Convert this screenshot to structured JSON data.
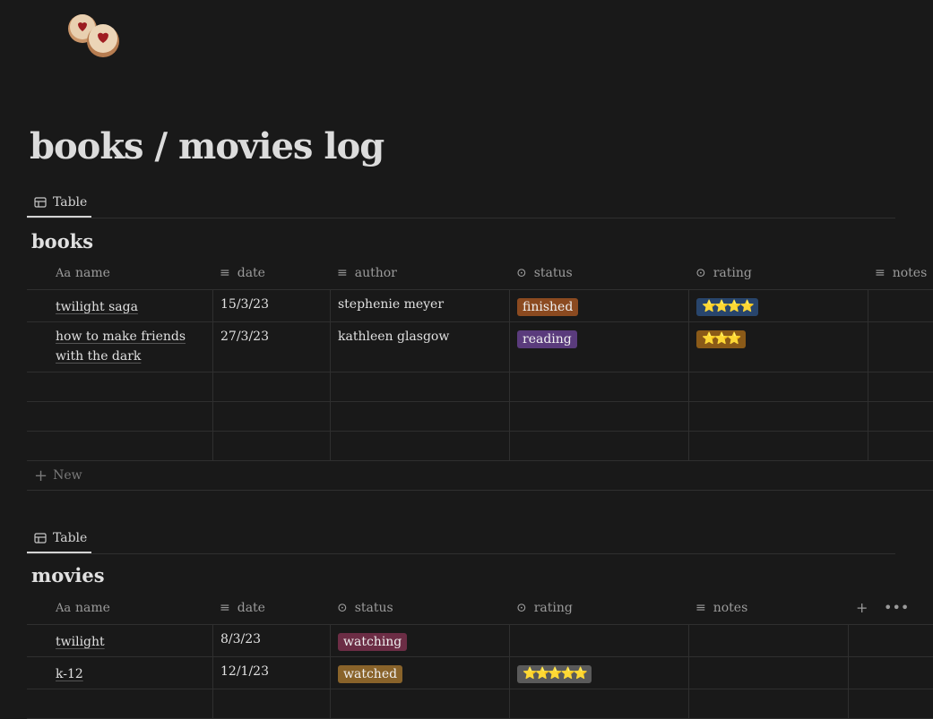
{
  "page": {
    "title": "books / movies log",
    "icon": "cookie-icon"
  },
  "books": {
    "view_tab": "Table",
    "title": "books",
    "columns": [
      "name",
      "date",
      "author",
      "status",
      "rating",
      "notes"
    ],
    "rows": [
      {
        "name": "twilight saga",
        "date": "15/3/23",
        "author": "stephenie meyer",
        "status": "finished",
        "status_color": "#8b4a20",
        "rating": "⭐⭐⭐⭐",
        "rating_bg": "#28456c"
      },
      {
        "name": "how to make friends with the dark",
        "date": "27/3/23",
        "author": "kathleen glasgow",
        "status": "reading",
        "status_color": "#5a3b7c",
        "rating": "⭐⭐⭐",
        "rating_bg": "#8a5a18"
      }
    ],
    "new_label": "New"
  },
  "movies": {
    "view_tab": "Table",
    "title": "movies",
    "columns": [
      "name",
      "date",
      "status",
      "rating",
      "notes"
    ],
    "rows": [
      {
        "name": "twilight",
        "date": "8/3/23",
        "status": "watching",
        "status_color": "#6c2d45",
        "rating": "",
        "rating_bg": ""
      },
      {
        "name": "k-12",
        "date": "12/1/23",
        "status": "watched",
        "status_color": "#89632a",
        "rating": "⭐⭐⭐⭐⭐",
        "rating_bg": "#5a5a5a"
      }
    ]
  },
  "colors": {
    "background": "#191919",
    "border": "#2f2f2f",
    "text": "#d4d4d4",
    "muted": "#9b9b9b"
  }
}
